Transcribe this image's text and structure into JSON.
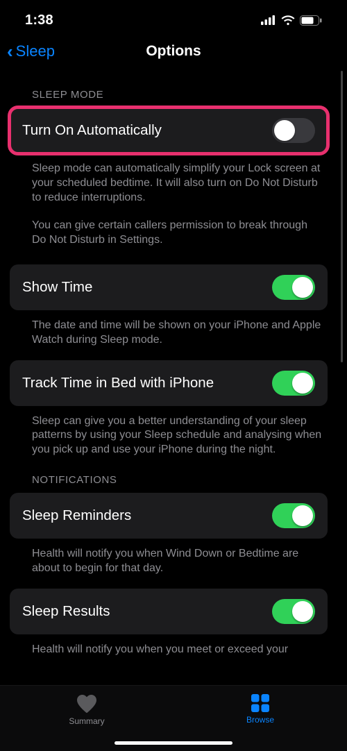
{
  "status": {
    "time": "1:38"
  },
  "nav": {
    "back_label": "Sleep",
    "title": "Options"
  },
  "sections": {
    "sleep_mode": {
      "header": "SLEEP MODE",
      "rows": {
        "auto": {
          "label": "Turn On Automatically",
          "on": false
        },
        "show_time": {
          "label": "Show Time",
          "on": true
        },
        "track": {
          "label": "Track Time in Bed with iPhone",
          "on": true
        }
      },
      "footer_auto1": "Sleep mode can automatically simplify your Lock screen at your scheduled bedtime. It will also turn on Do Not Disturb to reduce interruptions.",
      "footer_auto2": "You can give certain callers permission to break through Do Not Disturb in Settings.",
      "footer_show_time": "The date and time will be shown on your iPhone and Apple Watch during Sleep mode.",
      "footer_track": "Sleep can give you a better understanding of your sleep patterns by using your Sleep schedule and analysing when you pick up and use your iPhone during the night."
    },
    "notifications": {
      "header": "NOTIFICATIONS",
      "rows": {
        "reminders": {
          "label": "Sleep Reminders",
          "on": true
        },
        "results": {
          "label": "Sleep Results",
          "on": true
        }
      },
      "footer_reminders": "Health will notify you when Wind Down or Bedtime are about to begin for that day.",
      "footer_results": "Health will notify you when you meet or exceed your"
    }
  },
  "tabbar": {
    "summary": "Summary",
    "browse": "Browse"
  }
}
